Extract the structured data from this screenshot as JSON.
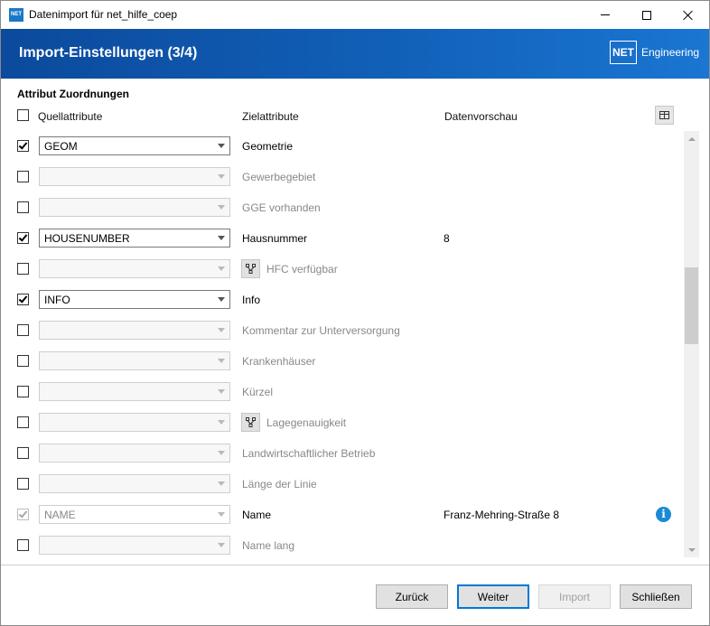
{
  "window": {
    "title": "Datenimport für net_hilfe_coep",
    "app_icon_text": "NET"
  },
  "banner": {
    "title": "Import-Einstellungen (3/4)",
    "brand_box": "NET",
    "brand_text": "Engineering",
    "colors": {
      "start": "#0b4a9c",
      "end": "#1a76d2"
    }
  },
  "section": {
    "title": "Attribut Zuordnungen",
    "col_source": "Quellattribute",
    "col_target": "Zielattribute",
    "col_preview": "Datenvorschau",
    "header_checkbox_checked": false
  },
  "rows": [
    {
      "checked": true,
      "disabled": false,
      "source": "GEOM",
      "target": "Geometrie",
      "active": true,
      "hfc": false,
      "preview": "",
      "info": false
    },
    {
      "checked": false,
      "disabled": false,
      "source": "",
      "target": "Gewerbegebiet",
      "active": false,
      "hfc": false,
      "preview": "",
      "info": false
    },
    {
      "checked": false,
      "disabled": false,
      "source": "",
      "target": "GGE vorhanden",
      "active": false,
      "hfc": false,
      "preview": "",
      "info": false
    },
    {
      "checked": true,
      "disabled": false,
      "source": "HOUSENUMBER",
      "target": "Hausnummer",
      "active": true,
      "hfc": false,
      "preview": "8",
      "info": false
    },
    {
      "checked": false,
      "disabled": false,
      "source": "",
      "target": "HFC verfügbar",
      "active": false,
      "hfc": true,
      "preview": "",
      "info": false
    },
    {
      "checked": true,
      "disabled": false,
      "source": "INFO",
      "target": "Info",
      "active": true,
      "hfc": false,
      "preview": "",
      "info": false
    },
    {
      "checked": false,
      "disabled": false,
      "source": "",
      "target": "Kommentar zur Unterversorgung",
      "active": false,
      "hfc": false,
      "preview": "",
      "info": false
    },
    {
      "checked": false,
      "disabled": false,
      "source": "",
      "target": "Krankenhäuser",
      "active": false,
      "hfc": false,
      "preview": "",
      "info": false
    },
    {
      "checked": false,
      "disabled": false,
      "source": "",
      "target": "Kürzel",
      "active": false,
      "hfc": false,
      "preview": "",
      "info": false
    },
    {
      "checked": false,
      "disabled": false,
      "source": "",
      "target": "Lagegenauigkeit",
      "active": false,
      "hfc": true,
      "preview": "",
      "info": false
    },
    {
      "checked": false,
      "disabled": false,
      "source": "",
      "target": "Landwirtschaftlicher Betrieb",
      "active": false,
      "hfc": false,
      "preview": "",
      "info": false
    },
    {
      "checked": false,
      "disabled": false,
      "source": "",
      "target": "Länge der Linie",
      "active": false,
      "hfc": false,
      "preview": "",
      "info": false
    },
    {
      "checked": true,
      "disabled": true,
      "source": "NAME",
      "target": "Name",
      "active": true,
      "hfc": false,
      "preview": "Franz-Mehring-Straße 8",
      "info": true
    },
    {
      "checked": false,
      "disabled": false,
      "source": "",
      "target": "Name lang",
      "active": false,
      "hfc": false,
      "preview": "",
      "info": false
    }
  ],
  "scroll": {
    "position_fraction": 0.47
  },
  "buttons": {
    "back": "Zurück",
    "next": "Weiter",
    "import": "Import",
    "close": "Schließen"
  },
  "icons": {
    "table_view": "table-icon",
    "hfc": "hierarchy-icon",
    "info": "info-icon",
    "info_glyph": "i"
  }
}
